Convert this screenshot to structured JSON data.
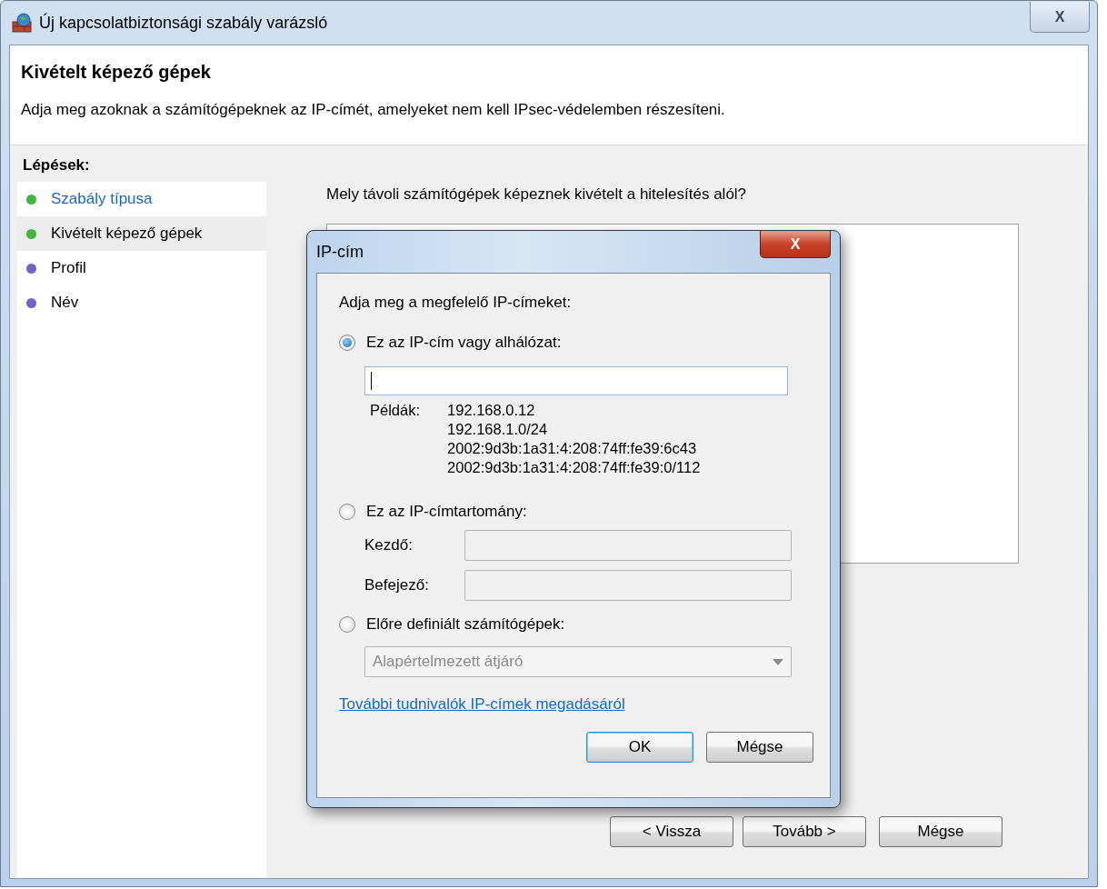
{
  "window": {
    "title": "Új kapcsolatbiztonsági szabály varázsló",
    "close_label": "X"
  },
  "header": {
    "title": "Kivételt képező gépek",
    "description": "Adja meg azoknak a számítógépeknek az IP-címét, amelyeket nem kell IPsec-védelemben részesíteni."
  },
  "steps_panel": {
    "title": "Lépések:",
    "steps": [
      {
        "label": "Szabály típusa",
        "kind": "link",
        "selected": false,
        "color": "#3fb83f"
      },
      {
        "label": "Kivételt képező gépek",
        "kind": "text",
        "selected": true,
        "color": "#3fb83f"
      },
      {
        "label": "Profil",
        "kind": "text",
        "selected": false,
        "color": "#6a66cc"
      },
      {
        "label": "Név",
        "kind": "text",
        "selected": false,
        "color": "#6a66cc"
      }
    ]
  },
  "question": "Mely távoli számítógépek képeznek kivételt a hitelesítés alól?",
  "buttons": [
    {
      "label": "< Vissza"
    },
    {
      "label": "Tovább >"
    },
    {
      "label": "Mégse"
    }
  ],
  "dialog": {
    "title": "IP-cím",
    "close_label": "X",
    "prompt": "Adja meg a megfelelő IP-címeket:",
    "options": [
      {
        "kind": "address",
        "label": "Ez az IP-cím vagy alhálózat:",
        "selected": true,
        "examples_label": "Példák:",
        "examples": [
          "192.168.0.12",
          "192.168.1.0/24",
          "2002:9d3b:1a31:4:208:74ff:fe39:6c43",
          "2002:9d3b:1a31:4:208:74ff:fe39:0/112"
        ]
      },
      {
        "kind": "range",
        "label": "Ez az IP-címtartomány:",
        "selected": false,
        "fields": [
          {
            "label": "Kezdő:",
            "disabled": true
          },
          {
            "label": "Befejező:",
            "disabled": true
          }
        ]
      },
      {
        "kind": "predefined",
        "label": "Előre definiált számítógépek:",
        "selected": false,
        "combo": {
          "value": "Alapértelmezett átjáró",
          "disabled": true
        }
      }
    ],
    "link": "További tudnivalók IP-címek megadásáról",
    "buttons": [
      {
        "label": "OK",
        "default": true
      },
      {
        "label": "Mégse",
        "default": false
      }
    ]
  }
}
